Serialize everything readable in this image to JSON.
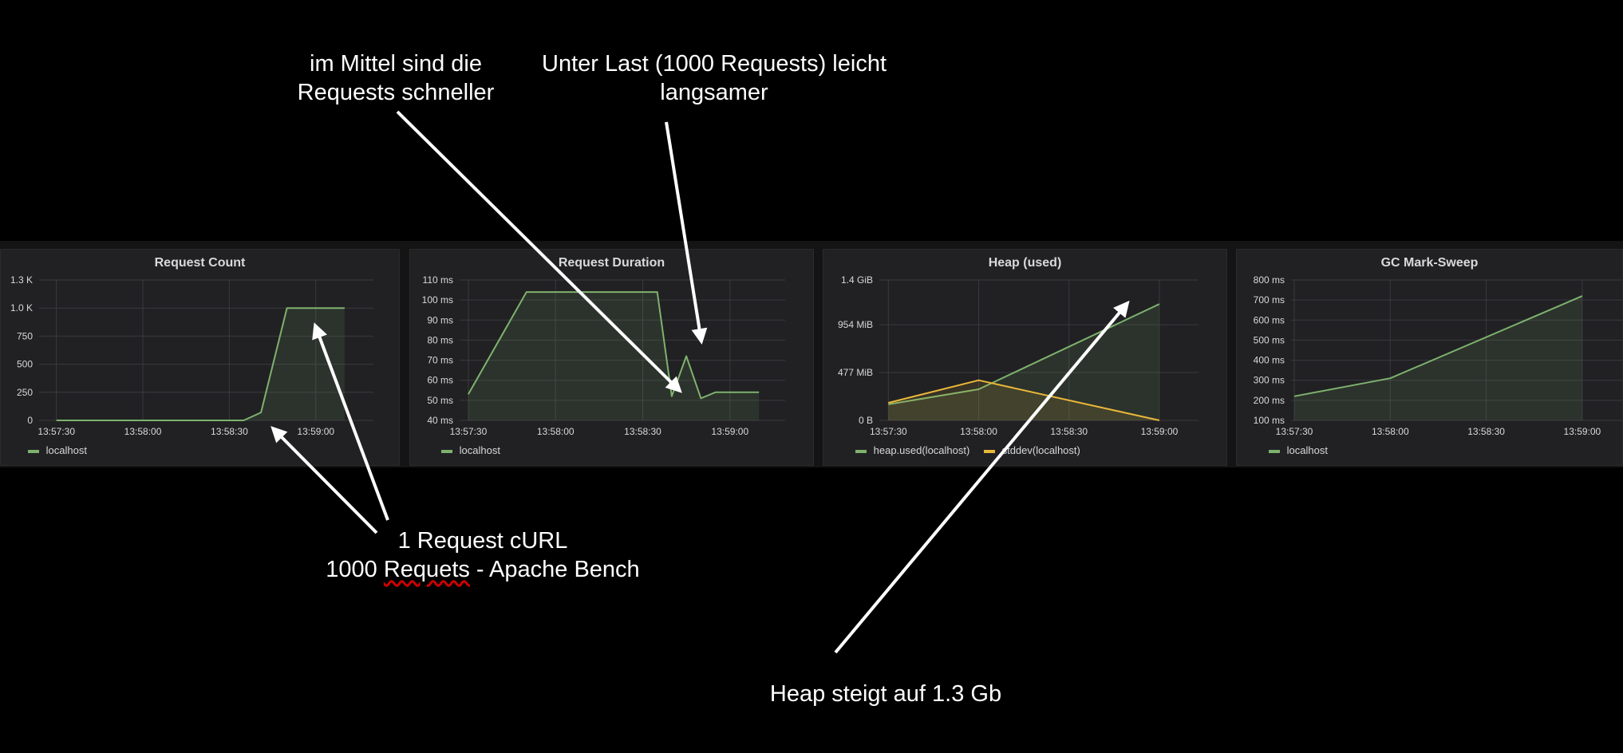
{
  "annotations": {
    "top_left": [
      "im Mittel sind die",
      "Requests schneller"
    ],
    "top_right": [
      "Unter Last (1000 Requests) leicht",
      "langsamer"
    ],
    "bottom_mid": [
      "1 Request cURL",
      "1000 ",
      "Requets",
      " - Apache Bench"
    ],
    "bottom_right": "Heap steigt auf 1.3 Gb"
  },
  "colors": {
    "green": "#7eb26d",
    "orange": "#eab839",
    "background": "#000000",
    "panel": "#212124"
  },
  "chart_data": [
    {
      "type": "area",
      "title": "Request Count",
      "y_ticks": [
        "1.3 K",
        "1.0 K",
        "750",
        "500",
        "250",
        "0"
      ],
      "y_tick_values": [
        1250,
        1000,
        750,
        500,
        250,
        0
      ],
      "ylim": [
        0,
        1250
      ],
      "x_ticks": [
        "13:57:30",
        "13:58:00",
        "13:58:30",
        "13:59:00"
      ],
      "x_tick_values": [
        1050,
        1080,
        1110,
        1140
      ],
      "xlim": [
        1044,
        1160
      ],
      "grid": true,
      "legend_position": "bottom-left",
      "series": [
        {
          "name": "localhost",
          "color": "#7eb26d",
          "x": [
            "13:57:30",
            "13:58:00",
            "13:58:25",
            "13:58:30",
            "13:58:35",
            "13:58:41",
            "13:58:50",
            "13:58:55",
            "13:59:00",
            "13:59:05",
            "13:59:10"
          ],
          "y": [
            0,
            0,
            0,
            0,
            0,
            70,
            1000,
            1000,
            1000,
            1000,
            1000
          ]
        }
      ]
    },
    {
      "type": "area",
      "title": "Request Duration",
      "y_ticks": [
        "110 ms",
        "100 ms",
        "90 ms",
        "80 ms",
        "70 ms",
        "60 ms",
        "50 ms",
        "40 ms"
      ],
      "y_tick_values": [
        110,
        100,
        90,
        80,
        70,
        60,
        50,
        40
      ],
      "ylim": [
        40,
        110
      ],
      "x_ticks": [
        "13:57:30",
        "13:58:00",
        "13:58:30",
        "13:59:00"
      ],
      "x_tick_values": [
        1050,
        1080,
        1110,
        1140
      ],
      "xlim": [
        1047,
        1159
      ],
      "grid": true,
      "legend_position": "bottom-left",
      "series": [
        {
          "name": "localhost",
          "color": "#7eb26d",
          "x": [
            "13:57:30",
            "13:57:50",
            "13:58:35",
            "13:58:40",
            "13:58:45",
            "13:58:50",
            "13:58:55",
            "13:59:00",
            "13:59:05",
            "13:59:10"
          ],
          "y": [
            53,
            104,
            104,
            52,
            72,
            51,
            54,
            54,
            54,
            54
          ]
        }
      ]
    },
    {
      "type": "area",
      "title": "Heap (used)",
      "y_ticks": [
        "1.4 GiB",
        "954 MiB",
        "477 MiB",
        "0 B"
      ],
      "y_tick_values": [
        1400,
        954,
        477,
        0
      ],
      "ylim": [
        0,
        1400
      ],
      "x_ticks": [
        "13:57:30",
        "13:58:00",
        "13:58:30",
        "13:59:00"
      ],
      "x_tick_values": [
        1050,
        1080,
        1110,
        1140
      ],
      "xlim": [
        1047,
        1153
      ],
      "grid": true,
      "legend_position": "bottom-left",
      "series": [
        {
          "name": "heap.used(localhost)",
          "color": "#7eb26d",
          "x": [
            "13:57:30",
            "13:58:00",
            "13:59:00"
          ],
          "y": [
            160,
            310,
            1160
          ]
        },
        {
          "name": "stddev(localhost)",
          "color": "#eab839",
          "x": [
            "13:57:30",
            "13:58:00",
            "13:59:00"
          ],
          "y": [
            175,
            400,
            0
          ]
        }
      ]
    },
    {
      "type": "area",
      "title": "GC Mark-Sweep",
      "y_ticks": [
        "800 ms",
        "700 ms",
        "600 ms",
        "500 ms",
        "400 ms",
        "300 ms",
        "200 ms",
        "100 ms"
      ],
      "y_tick_values": [
        800,
        700,
        600,
        500,
        400,
        300,
        200,
        100
      ],
      "ylim": [
        100,
        800
      ],
      "x_ticks": [
        "13:57:30",
        "13:58:00",
        "13:58:30",
        "13:59:00"
      ],
      "x_tick_values": [
        1050,
        1080,
        1110,
        1140
      ],
      "xlim": [
        1049,
        1153
      ],
      "grid": true,
      "legend_position": "bottom-left",
      "series": [
        {
          "name": "localhost",
          "color": "#7eb26d",
          "x": [
            "13:57:30",
            "13:58:00",
            "13:59:00"
          ],
          "y": [
            220,
            310,
            720
          ]
        }
      ]
    }
  ]
}
